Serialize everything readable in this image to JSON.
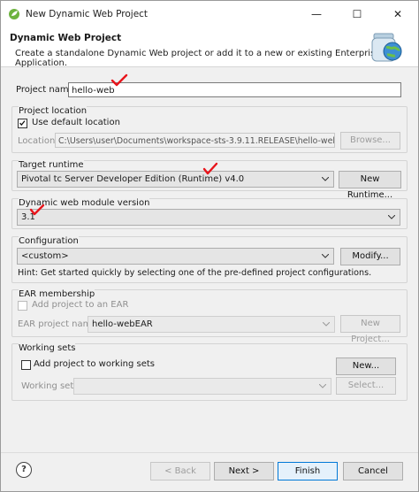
{
  "window": {
    "title": "New Dynamic Web Project",
    "controls": {
      "minimize": "—",
      "maximize": "☐",
      "close": "✕"
    }
  },
  "header": {
    "title": "Dynamic Web Project",
    "description": "Create a standalone Dynamic Web project or add it to a new or existing Enterprise Application."
  },
  "project_name": {
    "label": "Project name:",
    "value": "hello-web"
  },
  "project_location": {
    "group_label": "Project location",
    "use_default_label": "Use default location",
    "use_default_checked": true,
    "location_label": "Location:",
    "location_value": "C:\\Users\\user\\Documents\\workspace-sts-3.9.11.RELEASE\\hello-web",
    "browse_label": "Browse..."
  },
  "target_runtime": {
    "group_label": "Target runtime",
    "value": "Pivotal tc Server Developer Edition (Runtime) v4.0",
    "new_runtime_label": "New Runtime..."
  },
  "module_version": {
    "group_label": "Dynamic web module version",
    "value": "3.1"
  },
  "configuration": {
    "group_label": "Configuration",
    "value": "<custom>",
    "modify_label": "Modify...",
    "hint": "Hint: Get started quickly by selecting one of the pre-defined project configurations."
  },
  "ear_membership": {
    "group_label": "EAR membership",
    "add_label": "Add project to an EAR",
    "ear_name_label": "EAR project name:",
    "ear_name_value": "hello-webEAR",
    "new_project_label": "New Project..."
  },
  "working_sets": {
    "group_label": "Working sets",
    "add_label": "Add project to working sets",
    "new_label": "New...",
    "sets_label": "Working sets:",
    "select_label": "Select..."
  },
  "footer": {
    "help_icon": "?",
    "back_label": "< Back",
    "next_label": "Next >",
    "finish_label": "Finish",
    "cancel_label": "Cancel"
  },
  "colors": {
    "annotation_red": "#e8141b",
    "accent_blue": "#0078d7"
  }
}
